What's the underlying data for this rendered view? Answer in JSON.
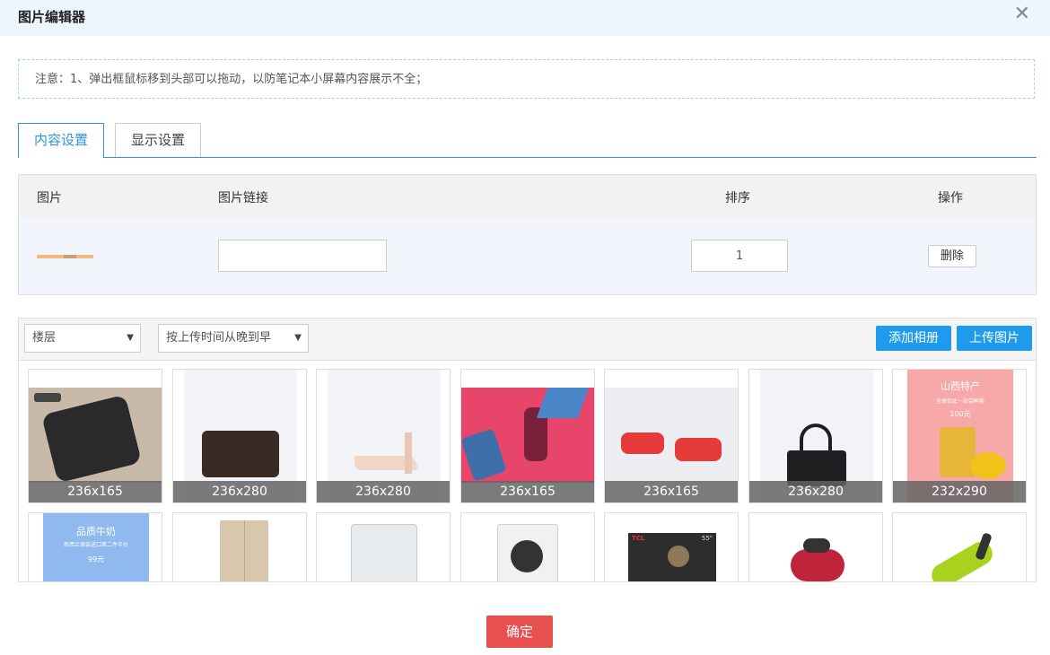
{
  "dialog": {
    "title": "图片编辑器"
  },
  "notice": "注意：1、弹出框鼠标移到头部可以拖动，以防笔记本小屏幕内容展示不全；",
  "tabs": [
    {
      "label": "内容设置",
      "active": true
    },
    {
      "label": "显示设置",
      "active": false
    }
  ],
  "table": {
    "headers": [
      "图片",
      "图片链接",
      "排序",
      "操作"
    ],
    "row": {
      "link_value": "",
      "sort_value": "1",
      "delete_label": "删除"
    }
  },
  "gallery": {
    "floor_select": "楼层",
    "sort_select": "按上传时间从晚到早",
    "add_album_label": "添加相册",
    "upload_label": "上传图片",
    "images": [
      {
        "caption": "236x165",
        "subject": "black leather clutch",
        "bg": "#c9b9a8"
      },
      {
        "caption": "236x280",
        "subject": "brown wallet",
        "bg": "#f3f3f7"
      },
      {
        "caption": "236x280",
        "subject": "pink high heel",
        "bg": "#f3f3f7"
      },
      {
        "caption": "236x165",
        "subject": "girl with suitcase",
        "bg": "#e8456a"
      },
      {
        "caption": "236x165",
        "subject": "red sandals",
        "bg": "#eceef2"
      },
      {
        "caption": "236x280",
        "subject": "black handbag",
        "bg": "#f3f3f7"
      },
      {
        "caption": "232x290",
        "subject": "山西特产",
        "bg": "#f7a8a8",
        "text": [
          "山西特产",
          "全球仅此一款尝鲜套",
          "100元"
        ]
      },
      {
        "caption": "",
        "subject": "品质牛奶",
        "bg": "#8fb9ef",
        "text": [
          "品质牛奶",
          "新西兰原装进口第二件半价",
          "99元"
        ]
      },
      {
        "caption": "",
        "subject": "refrigerator",
        "bg": "#ffffff"
      },
      {
        "caption": "",
        "subject": "washing machine top",
        "bg": "#ffffff"
      },
      {
        "caption": "",
        "subject": "washing machine front",
        "bg": "#ffffff"
      },
      {
        "caption": "",
        "subject": "TCL TV",
        "bg": "#ffffff",
        "text": [
          "TCL",
          "55\""
        ]
      },
      {
        "caption": "",
        "subject": "vacuum cleaner",
        "bg": "#ffffff"
      },
      {
        "caption": "",
        "subject": "handheld vacuum",
        "bg": "#ffffff"
      }
    ]
  },
  "confirm_label": "确定",
  "colors": {
    "accent": "#1e9bec",
    "danger": "#e85050"
  }
}
